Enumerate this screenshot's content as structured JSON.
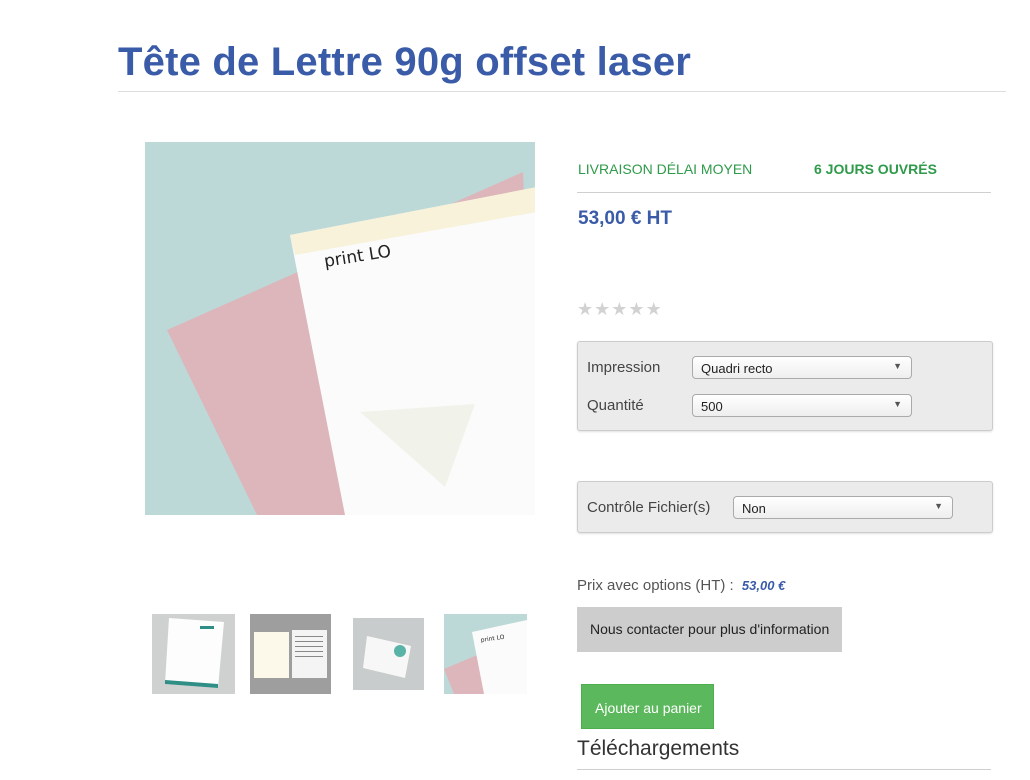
{
  "product": {
    "title": "Tête de Lettre 90g offset laser",
    "brand_logo_text": "print LO"
  },
  "delivery": {
    "label": "LIVRAISON DÉLAI MOYEN",
    "days": "6 JOURS OUVRÉS",
    "color": "#2e9a4a"
  },
  "price": {
    "main": "53,00 € HT",
    "options_label": "Prix avec options (HT) :",
    "options_value": "53,00 €"
  },
  "rating": {
    "stars": 5,
    "filled": 0,
    "icon": "star-icon"
  },
  "options": {
    "impression": {
      "label": "Impression",
      "value": "Quadri recto"
    },
    "quantite": {
      "label": "Quantité",
      "value": "500"
    },
    "controle": {
      "label": "Contrôle Fichier(s)",
      "value": "Non"
    }
  },
  "buttons": {
    "contact": "Nous contacter pour plus d'information",
    "add_to_cart": "Ajouter au panier"
  },
  "sections": {
    "downloads": "Téléchargements"
  },
  "colors": {
    "accent": "#3a5ba8",
    "add_button": "#5cb85c",
    "contact_button": "#cdcdcd"
  }
}
